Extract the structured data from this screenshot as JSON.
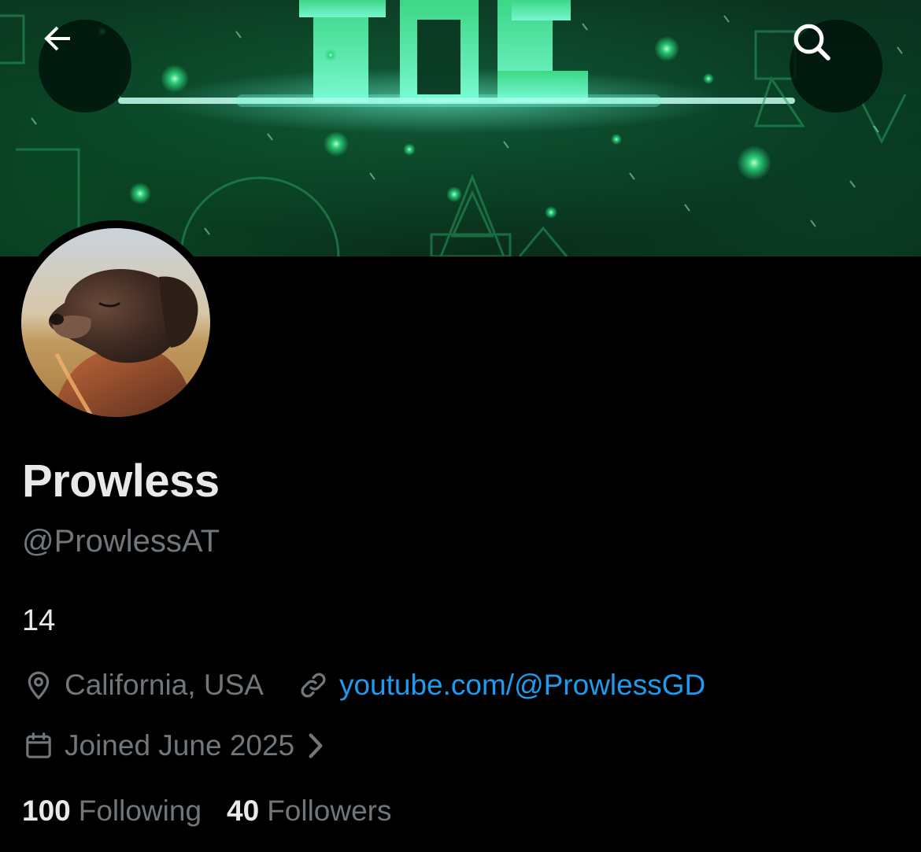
{
  "header": {
    "back_icon": "arrow-left-icon",
    "search_icon": "search-icon",
    "banner_text": "IOE"
  },
  "profile": {
    "display_name": "Prowless",
    "handle": "@ProwlessAT",
    "bio": "14",
    "location": "California, USA",
    "website": "youtube.com/@ProwlessGD",
    "joined": "Joined June 2025",
    "following_count": "100",
    "following_label": "Following",
    "followers_count": "40",
    "followers_label": "Followers"
  },
  "icons": {
    "location": "map-pin-icon",
    "link": "link-icon",
    "calendar": "calendar-icon",
    "chevron": "chevron-right-icon"
  },
  "colors": {
    "background": "#000000",
    "primary_text": "#e7e9ea",
    "secondary_text": "#71767b",
    "link": "#1d9bf0",
    "banner_green": "#2bd67b"
  }
}
